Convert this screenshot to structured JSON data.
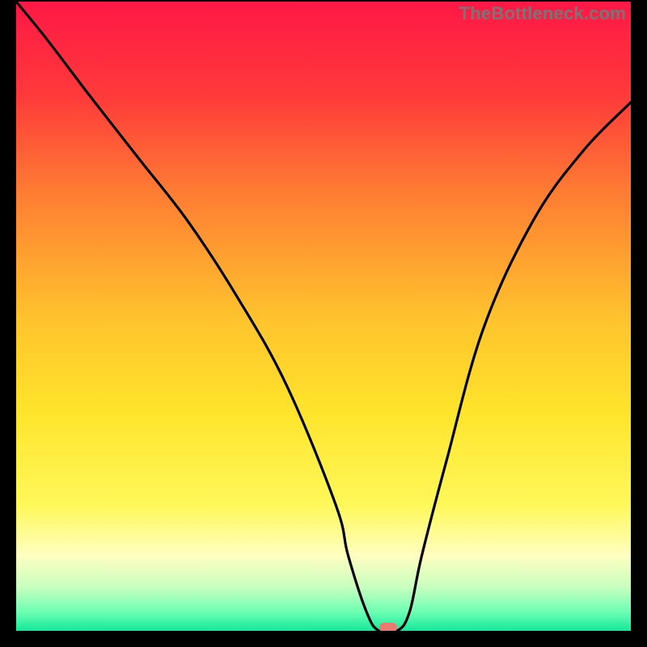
{
  "attribution": "TheBottleneck.com",
  "chart_data": {
    "type": "line",
    "title": "",
    "xlabel": "",
    "ylabel": "",
    "xlim": [
      0,
      100
    ],
    "ylim": [
      0,
      100
    ],
    "gradient_stops": [
      {
        "offset": 0,
        "color": "#ff1846"
      },
      {
        "offset": 0.15,
        "color": "#ff3a3a"
      },
      {
        "offset": 0.3,
        "color": "#ff7b33"
      },
      {
        "offset": 0.5,
        "color": "#ffc22d"
      },
      {
        "offset": 0.65,
        "color": "#ffe42b"
      },
      {
        "offset": 0.8,
        "color": "#fff85a"
      },
      {
        "offset": 0.88,
        "color": "#ffffc0"
      },
      {
        "offset": 0.93,
        "color": "#c9ffbf"
      },
      {
        "offset": 0.97,
        "color": "#6dffb3"
      },
      {
        "offset": 1.0,
        "color": "#15e89a"
      }
    ],
    "series": [
      {
        "name": "bottleneck-curve",
        "x": [
          0,
          5,
          12,
          20,
          28,
          36,
          44,
          52,
          54,
          57,
          59,
          62,
          64,
          66,
          70,
          76,
          84,
          92,
          100
        ],
        "y": [
          100,
          94,
          85,
          75,
          65,
          53,
          39,
          20,
          12,
          3,
          0,
          0,
          3,
          12,
          27,
          48,
          65,
          76,
          84
        ]
      }
    ],
    "marker": {
      "x": 60.5,
      "y": 0
    }
  }
}
